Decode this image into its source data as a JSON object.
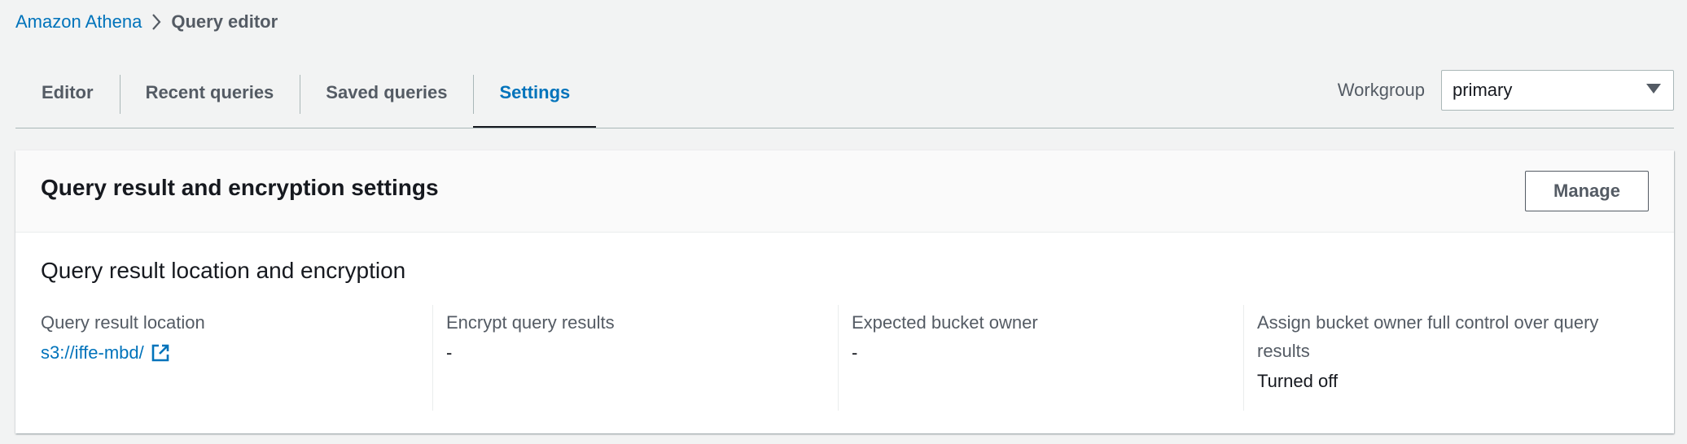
{
  "breadcrumb": {
    "parent": "Amazon Athena",
    "current": "Query editor"
  },
  "tabs": [
    {
      "label": "Editor",
      "active": false
    },
    {
      "label": "Recent queries",
      "active": false
    },
    {
      "label": "Saved queries",
      "active": false
    },
    {
      "label": "Settings",
      "active": true
    }
  ],
  "workgroup": {
    "label": "Workgroup",
    "value": "primary"
  },
  "panel": {
    "title": "Query result and encryption settings",
    "manage_label": "Manage",
    "section_title": "Query result location and encryption",
    "fields": {
      "location_label": "Query result location",
      "location_value": "s3://iffe-mbd/",
      "encrypt_label": "Encrypt query results",
      "encrypt_value": "-",
      "owner_label": "Expected bucket owner",
      "owner_value": "-",
      "control_label": "Assign bucket owner full control over query results",
      "control_value": "Turned off"
    }
  },
  "colors": {
    "link": "#0073bb",
    "background": "#f2f3f3",
    "text": "#16191f",
    "muted": "#545b64"
  }
}
